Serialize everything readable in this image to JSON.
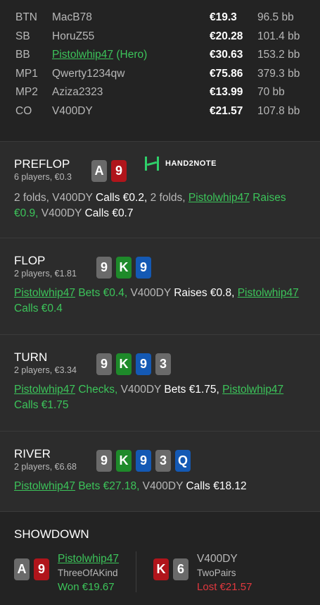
{
  "players": [
    {
      "pos": "BTN",
      "name": "MacB78",
      "hero": false,
      "stack": "€19.3",
      "bb": "96.5 bb"
    },
    {
      "pos": "SB",
      "name": "HoruZ55",
      "hero": false,
      "stack": "€20.28",
      "bb": "101.4 bb"
    },
    {
      "pos": "BB",
      "name": "Pistolwhip47",
      "hero": true,
      "hero_tag": "(Hero)",
      "stack": "€30.63",
      "bb": "153.2 bb"
    },
    {
      "pos": "MP1",
      "name": "Qwerty1234qw",
      "hero": false,
      "stack": "€75.86",
      "bb": "379.3 bb"
    },
    {
      "pos": "MP2",
      "name": "Aziza2323",
      "hero": false,
      "stack": "€13.99",
      "bb": "70 bb"
    },
    {
      "pos": "CO",
      "name": "V400DY",
      "hero": false,
      "stack": "€21.57",
      "bb": "107.8 bb"
    }
  ],
  "logo_text": "HAND2NOTE",
  "streets": [
    {
      "name": "PREFLOP",
      "sub": "6 players, €0.3",
      "cards": [
        {
          "r": "A",
          "c": "grey"
        },
        {
          "r": "9",
          "c": "red"
        }
      ],
      "actions": [
        {
          "t": "2 folds, ",
          "k": "plain"
        },
        {
          "t": "V400DY ",
          "k": "plain"
        },
        {
          "t": "Calls €0.2,",
          "k": "w"
        },
        {
          "t": " 2 folds, ",
          "k": "plain"
        },
        {
          "t": "Pistolwhip47",
          "k": "pl"
        },
        {
          "t": " Raises €0.9,",
          "k": "g"
        },
        {
          "t": " V400DY ",
          "k": "plain"
        },
        {
          "t": "Calls €0.7",
          "k": "w"
        }
      ]
    },
    {
      "name": "FLOP",
      "sub": "2 players, €1.81",
      "cards": [
        {
          "r": "9",
          "c": "grey"
        },
        {
          "r": "K",
          "c": "green"
        },
        {
          "r": "9",
          "c": "blue"
        }
      ],
      "actions": [
        {
          "t": "Pistolwhip47",
          "k": "pl"
        },
        {
          "t": " Bets €0.4,",
          "k": "g"
        },
        {
          "t": " V400DY ",
          "k": "plain"
        },
        {
          "t": "Raises €0.8,",
          "k": "w"
        },
        {
          "t": " ",
          "k": "plain"
        },
        {
          "t": "Pistolwhip47",
          "k": "pl"
        },
        {
          "t": " Calls €0.4",
          "k": "g"
        }
      ]
    },
    {
      "name": "TURN",
      "sub": "2 players, €3.34",
      "cards": [
        {
          "r": "9",
          "c": "grey"
        },
        {
          "r": "K",
          "c": "green"
        },
        {
          "r": "9",
          "c": "blue"
        },
        {
          "r": "3",
          "c": "grey"
        }
      ],
      "actions": [
        {
          "t": "Pistolwhip47",
          "k": "pl"
        },
        {
          "t": " Checks,",
          "k": "g"
        },
        {
          "t": " V400DY ",
          "k": "plain"
        },
        {
          "t": "Bets €1.75,",
          "k": "w"
        },
        {
          "t": " ",
          "k": "plain"
        },
        {
          "t": "Pistolwhip47",
          "k": "pl"
        },
        {
          "t": " Calls €1.75",
          "k": "g"
        }
      ]
    },
    {
      "name": "RIVER",
      "sub": "2 players, €6.68",
      "cards": [
        {
          "r": "9",
          "c": "grey"
        },
        {
          "r": "K",
          "c": "green"
        },
        {
          "r": "9",
          "c": "blue"
        },
        {
          "r": "3",
          "c": "grey"
        },
        {
          "r": "Q",
          "c": "blue"
        }
      ],
      "actions": [
        {
          "t": "Pistolwhip47",
          "k": "pl"
        },
        {
          "t": " Bets €27.18,",
          "k": "g"
        },
        {
          "t": " V400DY ",
          "k": "plain"
        },
        {
          "t": "Calls €18.12",
          "k": "w"
        }
      ]
    }
  ],
  "showdown": {
    "title": "SHOWDOWN",
    "players": [
      {
        "name": "Pistolwhip47",
        "hero": true,
        "hand": "ThreeOfAKind",
        "result": "Won €19.67",
        "won": true,
        "cards": [
          {
            "r": "A",
            "c": "grey"
          },
          {
            "r": "9",
            "c": "red"
          }
        ]
      },
      {
        "name": "V400DY",
        "hero": false,
        "hand": "TwoPairs",
        "result": "Lost €21.57",
        "won": false,
        "cards": [
          {
            "r": "K",
            "c": "red"
          },
          {
            "r": "6",
            "c": "grey"
          }
        ]
      }
    ]
  },
  "colors": {
    "green": "#3cc45a",
    "red_text": "#e0383e",
    "card_grey": "#6a6a6a",
    "card_red": "#b0151b",
    "card_green": "#1e8a2a",
    "card_blue": "#1459b4"
  }
}
